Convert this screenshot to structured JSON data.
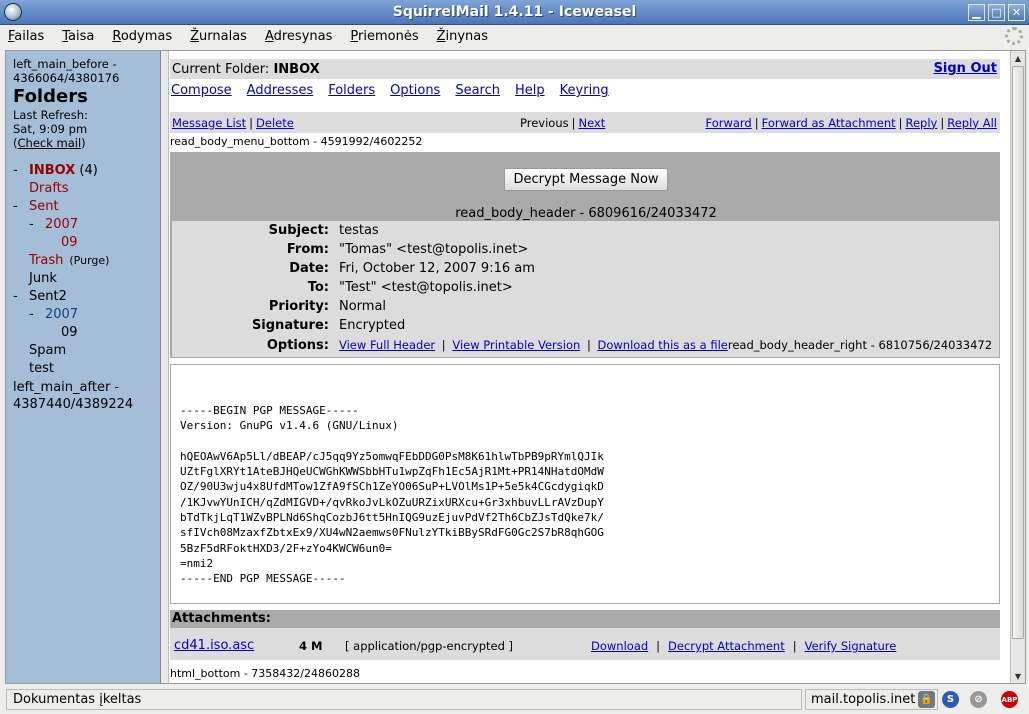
{
  "window": {
    "title": "SquirrelMail 1.4.11 - Iceweasel"
  },
  "menu": [
    {
      "u": "F",
      "rest": "ailas"
    },
    {
      "u": "T",
      "rest": "aisa"
    },
    {
      "u": "R",
      "rest": "odymas"
    },
    {
      "u": "Ž",
      "rest": "urnalas"
    },
    {
      "u": "A",
      "rest": "dresynas"
    },
    {
      "u": "P",
      "rest": "riemonės"
    },
    {
      "u": "Ž",
      "rest": "inynas"
    }
  ],
  "left": {
    "debug_before_1": "left_main_before -",
    "debug_before_2": "4366064/4380176",
    "heading": "Folders",
    "last_refresh": "Last Refresh:",
    "refresh_time": "Sat, 9:09 pm",
    "check_mail_open": "(",
    "check_mail": "Check mail",
    "check_mail_close": ")",
    "folders": {
      "inbox": {
        "dash": "-",
        "label": "INBOX",
        "count": "(4)"
      },
      "drafts": {
        "label": "Drafts"
      },
      "sent": {
        "dash": "-",
        "label": "Sent"
      },
      "sent_2007": {
        "dash": "-",
        "label": "2007"
      },
      "sent_2007_09": {
        "label": "09"
      },
      "trash": {
        "label": "Trash",
        "purge": "(Purge)"
      },
      "junk": {
        "label": "Junk"
      },
      "sent2": {
        "dash": "-",
        "label": "Sent2"
      },
      "sent2_2007": {
        "dash": "-",
        "label": "2007"
      },
      "sent2_2007_09": {
        "label": "09"
      },
      "spam": {
        "label": "Spam"
      },
      "test": {
        "label": "test"
      }
    },
    "debug_after_1": "left_main_after -",
    "debug_after_2": "4387440/4389224"
  },
  "main": {
    "current_folder_label": "Current Folder:",
    "current_folder": "INBOX",
    "sign_out": "Sign Out",
    "nav": [
      "Compose",
      "Addresses",
      "Folders",
      "Options",
      "Search",
      "Help",
      "Keyring"
    ],
    "msg_menu": {
      "message_list": "Message List",
      "delete": "Delete",
      "previous": "Previous",
      "next": "Next",
      "forward": "Forward",
      "forward_attachment": "Forward as Attachment",
      "reply": "Reply",
      "reply_all": "Reply All",
      "sep": "|"
    },
    "debug_menu_bottom": "read_body_menu_bottom - 4591992/4602252",
    "decrypt_button": "Decrypt Message Now",
    "debug_header": "read_body_header - 6809616/24033472",
    "header": {
      "subject_label": "Subject:",
      "subject": "testas",
      "from_label": "From:",
      "from": "\"Tomas\" <test@topolis.inet>",
      "date_label": "Date:",
      "date": "Fri, October 12, 2007 9:16 am",
      "to_label": "To:",
      "to": "\"Test\" <test@topolis.inet>",
      "priority_label": "Priority:",
      "priority": "Normal",
      "signature_label": "Signature:",
      "signature": "Encrypted",
      "options_label": "Options:",
      "view_full_header": "View Full Header",
      "view_printable": "View Printable Version",
      "download_file": "Download this as a file",
      "debug_header_right": "read_body_header_right - 6810756/24033472"
    },
    "body_text": "-----BEGIN PGP MESSAGE-----\nVersion: GnuPG v1.4.6 (GNU/Linux)\n\nhQEOAwV6Ap5Ll/dBEAP/cJ5qq9Yz5omwqFEbDDG0PsM8K61hlwTbPB9pRYmlQJIk\nUZtFglXRYt1AteBJHQeUCWGhKWWSbbHTu1wpZqFh1Ec5AjR1Mt+PR14NHatdOMdW\nOZ/90U3wju4x8UfdMTow1ZfA9fSCh1ZeYO06SuP+LVOlMs1P+5e5k4CGcdygiqkD\n/1KJvwYUnICH/qZdMIGVD+/qvRkoJvLkOZuURZixURXcu+Gr3xhbuvLLrAVzDupY\nbTdTkjLqT1WZvBPLNd6ShqCozbJ6tt5HnIQG9uzEjuvPdVf2Th6CbZJsTdQke7k/\nsfIVch08MzaxfZbtxEx9/XU4wN2aemws0FNulzYTkiBBySRdFG0Gc2S7bR8qhGOG\n5BzF5dRFoktHXD3/2F+zYo4KWCW6un0=\n=nmi2\n-----END PGP MESSAGE-----",
    "attachments": {
      "heading": "Attachments:",
      "filename": "cd41.iso.asc",
      "size": "4 M",
      "type": "[ application/pgp-encrypted ]",
      "download": "Download",
      "decrypt": "Decrypt Attachment",
      "verify": "Verify Signature",
      "sep": "|"
    },
    "debug_html_bottom": "html_bottom - 7358432/24860288"
  },
  "status": {
    "text": "Dokumentas įkeltas",
    "host": "mail.topolis.inet",
    "icons": [
      "lock-icon",
      "s-icon",
      "noscript-icon",
      "adblock-icon"
    ],
    "adblock_label": "ABP",
    "s_label": "S"
  },
  "colors": {
    "folder_red": "#990000",
    "folder_blue": "#10427a",
    "left_bg": "#a3bed6",
    "header_bg": "#dcdcdc",
    "link": "#0000cc"
  }
}
